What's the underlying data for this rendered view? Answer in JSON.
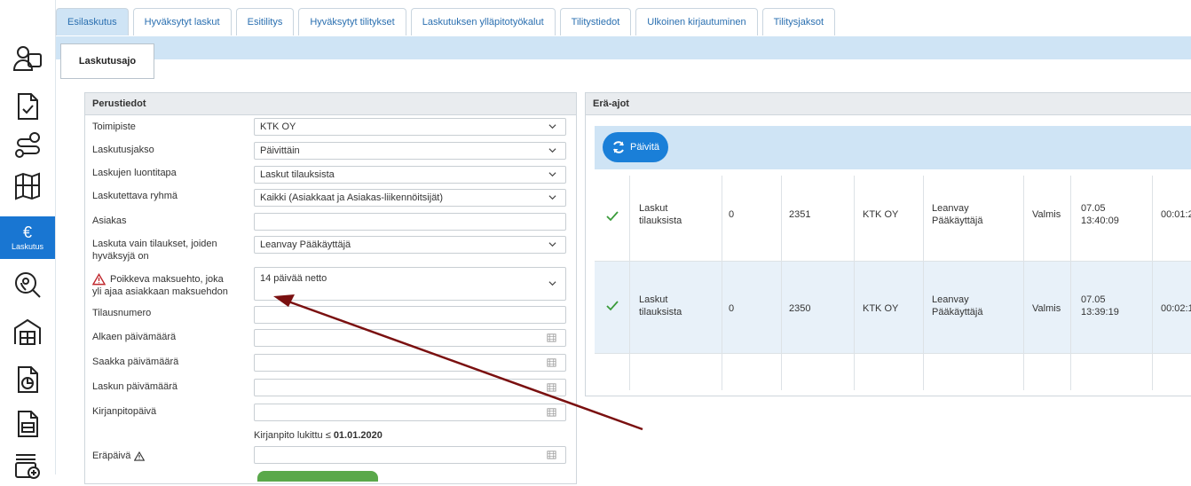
{
  "rail": {
    "active_label": "Laskutus"
  },
  "tabs": [
    "Esilaskutus",
    "Hyväksytyt laskut",
    "Esitilitys",
    "Hyväksytyt tilitykset",
    "Laskutuksen ylläpitotyökalut",
    "Tilitystiedot",
    "Ulkoinen kirjautuminen",
    "Tilitysjaksot"
  ],
  "subtab": "Laskutusajo",
  "form": {
    "title": "Perustiedot",
    "toimipiste": {
      "label": "Toimipiste",
      "value": "KTK OY"
    },
    "laskutusjakso": {
      "label": "Laskutusjakso",
      "value": "Päivittäin"
    },
    "luontitapa": {
      "label": "Laskujen luontitapa",
      "value": "Laskut tilauksista"
    },
    "ryhma": {
      "label": "Laskutettava ryhmä",
      "value": "Kaikki (Asiakkaat ja Asiakas-liikennöitsijät)"
    },
    "asiakas": {
      "label": "Asiakas",
      "value": ""
    },
    "hyvaksyja": {
      "label_1": "Laskuta vain tilaukset, joiden",
      "label_2": "hyväksyjä on",
      "value": "Leanvay Pääkäyttäjä"
    },
    "maksuehto": {
      "label_1": "Poikkeva maksuehto, joka",
      "label_2": "yli ajaa asiakkaan maksuehdon",
      "value": "14 päivää netto"
    },
    "tilausnumero": {
      "label": "Tilausnumero",
      "value": ""
    },
    "alkaen": {
      "label": "Alkaen päivämäärä"
    },
    "saakka": {
      "label": "Saakka päivämäärä"
    },
    "laskun_pvm": {
      "label": "Laskun päivämäärä"
    },
    "kirjanpitopaiva": {
      "label": "Kirjanpitopäivä"
    },
    "lukittu_prefix": "Kirjanpito lukittu ≤ ",
    "lukittu_date": "01.01.2020",
    "erapaiva": {
      "label": "Eräpäivä"
    }
  },
  "batch": {
    "title": "Erä-ajot",
    "refresh_label": "Päivitä",
    "rows": [
      {
        "type_1": "Laskut",
        "type_2": "tilauksista",
        "count": "0",
        "id": "2351",
        "company": "KTK OY",
        "user_1": "Leanvay",
        "user_2": "Pääkäyttäjä",
        "status": "Valmis",
        "date": "07.05",
        "time": "13:40:09",
        "duration": "00:01:2"
      },
      {
        "type_1": "Laskut",
        "type_2": "tilauksista",
        "count": "0",
        "id": "2350",
        "company": "KTK OY",
        "user_1": "Leanvay",
        "user_2": "Pääkäyttäjä",
        "status": "Valmis",
        "date": "07.05",
        "time": "13:39:19",
        "duration": "00:02:1"
      }
    ]
  },
  "colors": {
    "accent": "#1976d2",
    "tab_bg": "#cfe4f5",
    "check": "#3a9b3a",
    "arrow": "#7a1010"
  }
}
